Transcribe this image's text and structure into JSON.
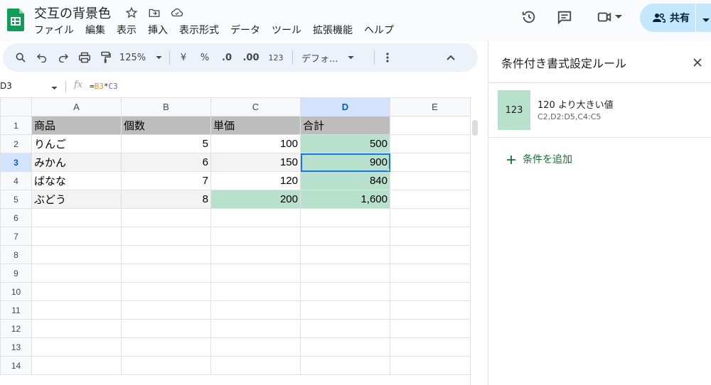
{
  "doc": {
    "title": "交互の背景色"
  },
  "menu": [
    "ファイル",
    "編集",
    "表示",
    "挿入",
    "表示形式",
    "データ",
    "ツール",
    "拡張機能",
    "ヘルプ"
  ],
  "header": {
    "share_label": "共有"
  },
  "toolbar": {
    "zoom": "125%",
    "currency": "¥",
    "percent": "%",
    "dec_decrease": ".0",
    "dec_increase": ".00",
    "number_format": "123",
    "font": "デフォ..."
  },
  "formula_bar": {
    "name_box": "D3",
    "fx": "fx",
    "formula_eq": "=",
    "formula_ref1": "B3",
    "formula_op": "*",
    "formula_ref2": "C3"
  },
  "sheet": {
    "columns": [
      "A",
      "B",
      "C",
      "D",
      "E"
    ],
    "rows": [
      "1",
      "2",
      "3",
      "4",
      "5",
      "6",
      "7",
      "8",
      "9",
      "10",
      "11",
      "12",
      "13",
      "14"
    ],
    "cells": [
      [
        "商品",
        "個数",
        "単価",
        "合計"
      ],
      [
        "りんご",
        "5",
        "100",
        "500"
      ],
      [
        "みかん",
        "6",
        "150",
        "900"
      ],
      [
        "ばなな",
        "7",
        "120",
        "840"
      ],
      [
        "ぶどう",
        "8",
        "200",
        "1,600"
      ]
    ],
    "selected_cell": "D3",
    "highlight_color": "#b7e1cd",
    "header_row_color": "#bdbdbd",
    "band_color": "#f3f3f3"
  },
  "panel": {
    "title": "条件付き書式設定ルール",
    "rule_preview": "123",
    "rule_name": "120 より大きい値",
    "rule_range": "C2,D2:D5,C4:C5",
    "add_rule_label": "条件を追加",
    "accent": "#137333"
  }
}
